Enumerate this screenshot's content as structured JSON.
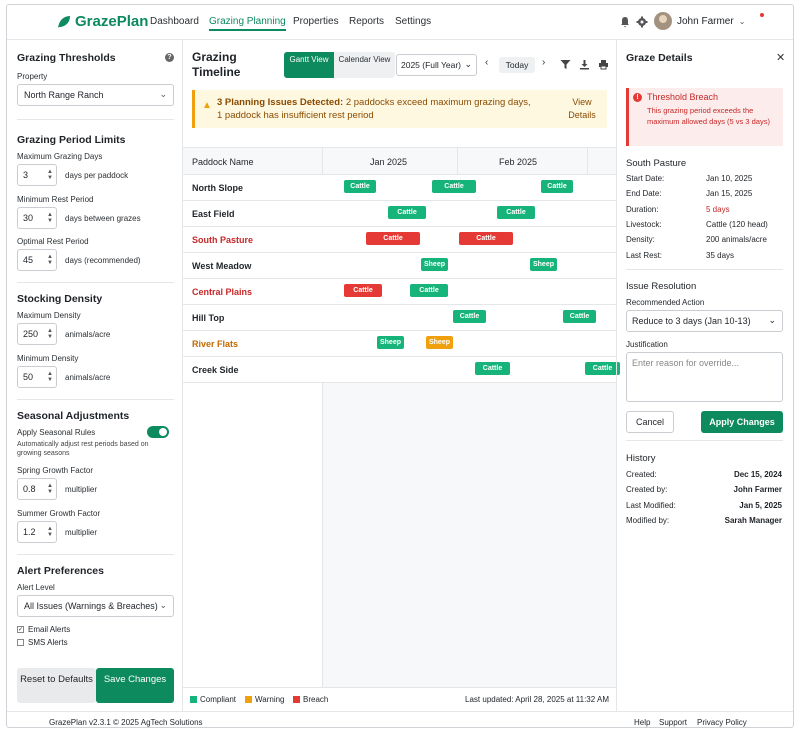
{
  "app": {
    "name": "GrazePlan",
    "nav": [
      "Dashboard",
      "Grazing Planning",
      "Properties",
      "Reports",
      "Settings"
    ],
    "user": "John Farmer"
  },
  "left": {
    "title": "Grazing Thresholds",
    "property_label": "Property",
    "property_value": "North Range Ranch",
    "period_title": "Grazing Period Limits",
    "max_days_label": "Maximum Grazing Days",
    "max_days_value": "3",
    "max_days_unit": "days per paddock",
    "min_rest_label": "Minimum Rest Period",
    "min_rest_value": "30",
    "min_rest_unit": "days between grazes",
    "opt_rest_label": "Optimal Rest Period",
    "opt_rest_value": "45",
    "opt_rest_unit": "days (recommended)",
    "density_title": "Stocking Density",
    "max_density_label": "Maximum Density",
    "max_density_value": "250",
    "max_density_unit": "animals/acre",
    "min_density_label": "Minimum Density",
    "min_density_value": "50",
    "min_density_unit": "animals/acre",
    "seasonal_title": "Seasonal Adjustments",
    "seasonal_rules_label": "Apply Seasonal Rules",
    "seasonal_note": "Automatically adjust rest periods based on growing seasons",
    "spring_label": "Spring Growth Factor",
    "spring_value": "0.8",
    "spring_unit": "multiplier",
    "summer_label": "Summer Growth Factor",
    "summer_value": "1.2",
    "summer_unit": "multiplier",
    "alert_title": "Alert Preferences",
    "alert_level_label": "Alert Level",
    "alert_level_value": "All Issues (Warnings & Breaches)",
    "email_alerts": "Email Alerts",
    "sms_alerts": "SMS Alerts",
    "reset_btn": "Reset to Defaults",
    "save_btn": "Save Changes"
  },
  "center": {
    "title": "Grazing Timeline",
    "view_gantt": "Gantt View",
    "view_calendar": "Calendar View",
    "year": "2025 (Full Year)",
    "today": "Today",
    "alert_strong": "3 Planning Issues Detected:",
    "alert_text": "2 paddocks exceed maximum grazing days, 1 paddock has insufficient rest period",
    "view_details": "View Details",
    "col_name": "Paddock Name",
    "months": [
      "Jan 2025",
      "Feb 2025"
    ],
    "rows": [
      {
        "name": "North Slope",
        "status": "ok",
        "bars": [
          {
            "label": "Cattle",
            "type": "ok"
          },
          {
            "label": "Cattle",
            "type": "ok"
          },
          {
            "label": "Cattle",
            "type": "ok"
          }
        ]
      },
      {
        "name": "East Field",
        "status": "ok",
        "bars": [
          {
            "label": "Cattle",
            "type": "ok"
          },
          {
            "label": "Cattle",
            "type": "ok"
          }
        ]
      },
      {
        "name": "South Pasture",
        "status": "breach",
        "bars": [
          {
            "label": "Cattle",
            "type": "breach"
          },
          {
            "label": "Cattle",
            "type": "breach"
          }
        ]
      },
      {
        "name": "West Meadow",
        "status": "ok",
        "bars": [
          {
            "label": "Sheep",
            "type": "ok"
          },
          {
            "label": "Sheep",
            "type": "ok"
          }
        ]
      },
      {
        "name": "Central Plains",
        "status": "breach",
        "bars": [
          {
            "label": "Cattle",
            "type": "breach"
          },
          {
            "label": "Cattle",
            "type": "ok"
          }
        ]
      },
      {
        "name": "Hill Top",
        "status": "ok",
        "bars": [
          {
            "label": "Cattle",
            "type": "ok"
          },
          {
            "label": "Cattle",
            "type": "ok"
          }
        ]
      },
      {
        "name": "River Flats",
        "status": "warning",
        "bars": [
          {
            "label": "Sheep",
            "type": "ok"
          },
          {
            "label": "Sheep",
            "type": "warning"
          }
        ]
      },
      {
        "name": "Creek Side",
        "status": "ok",
        "bars": [
          {
            "label": "Cattle",
            "type": "ok"
          },
          {
            "label": "Cattle",
            "type": "ok"
          }
        ]
      }
    ],
    "legend": [
      "Compliant",
      "Warning",
      "Breach"
    ],
    "last_updated": "Last updated: April 28, 2025 at 11:32 AM"
  },
  "right": {
    "title": "Graze Details",
    "breach_title": "Threshold Breach",
    "breach_text": "This grazing period exceeds the maximum allowed days (5 vs 3 days)",
    "paddock": "South Pasture",
    "details": [
      {
        "k": "Start Date:",
        "v": "Jan 10, 2025"
      },
      {
        "k": "End Date:",
        "v": "Jan 15, 2025"
      },
      {
        "k": "Duration:",
        "v": "5 days"
      },
      {
        "k": "Livestock:",
        "v": "Cattle (120 head)"
      },
      {
        "k": "Density:",
        "v": "200 animals/acre"
      },
      {
        "k": "Last Rest:",
        "v": "35 days"
      }
    ],
    "resolution_title": "Issue Resolution",
    "rec_label": "Recommended Action",
    "rec_value": "Reduce to 3 days (Jan 10-13)",
    "just_label": "Justification",
    "just_placeholder": "Enter reason for override...",
    "cancel": "Cancel",
    "apply": "Apply Changes",
    "history_title": "History",
    "history": [
      {
        "k": "Created:",
        "v": "Dec 15, 2024"
      },
      {
        "k": "Created by:",
        "v": "John Farmer"
      },
      {
        "k": "Last Modified:",
        "v": "Jan 5, 2025"
      },
      {
        "k": "Modified by:",
        "v": "Sarah Manager"
      }
    ]
  },
  "footer": {
    "copy": "GrazePlan v2.3.1 © 2025 AgTech Solutions",
    "links": [
      "Help",
      "Support",
      "Privacy Policy"
    ]
  },
  "colors": {
    "ok": "#16b47a",
    "warning": "#f0a00c",
    "breach": "#e53935",
    "brand": "#0e8a5f"
  }
}
